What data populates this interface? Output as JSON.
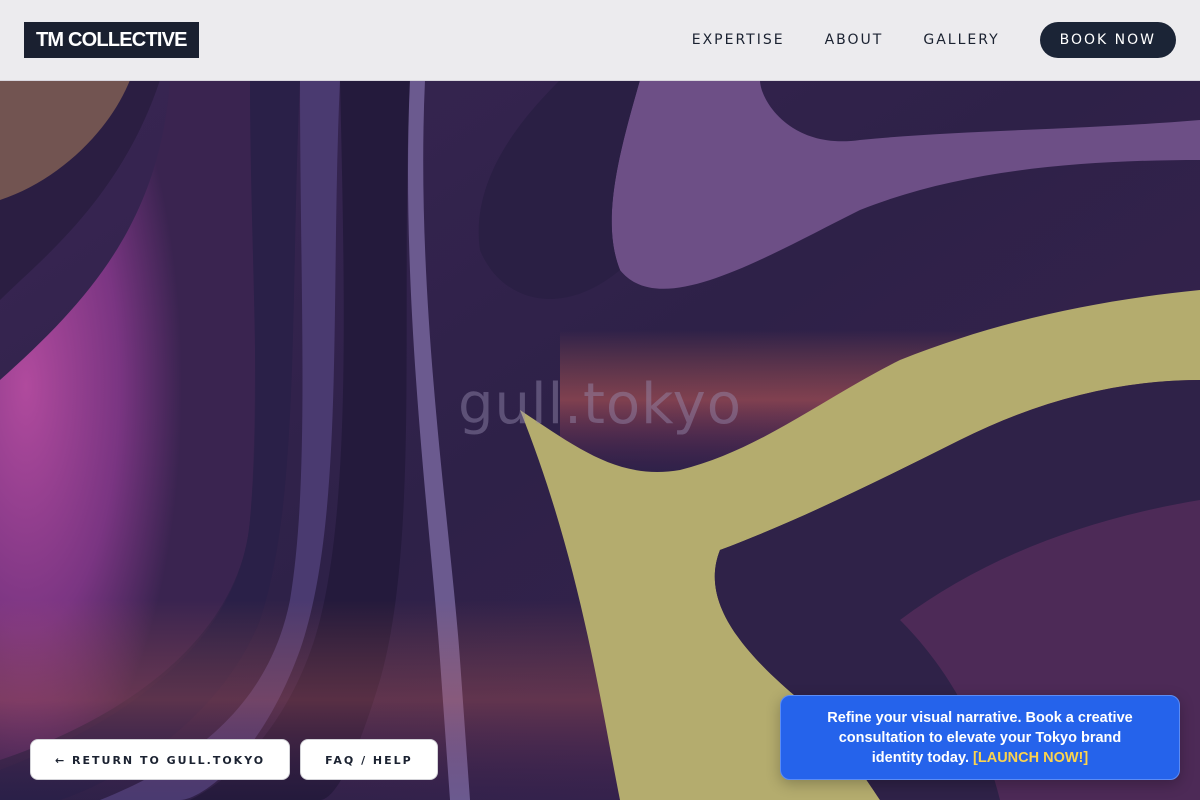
{
  "header": {
    "logo": "TM COLLECTIVE",
    "nav": [
      "EXPERTISE",
      "ABOUT",
      "GALLERY"
    ],
    "cta_label": "BOOK NOW"
  },
  "hero": {
    "watermark": "gull.tokyo"
  },
  "footer_buttons": {
    "return_label": "← RETURN TO GULL.TOKYO",
    "faq_label": "FAQ / HELP"
  },
  "promo": {
    "text": "Refine your visual narrative. Book a creative consultation to elevate your Tokyo brand identity today.",
    "cta": "[LAUNCH NOW!]"
  },
  "colors": {
    "header_bg": "#ecebee",
    "logo_bg": "#1a2030",
    "cta_bg": "#1b2436",
    "promo_bg": "#2563eb",
    "promo_cta": "#fcd34d",
    "art_purple": "#2e2148",
    "art_magenta": "#9a3d8d",
    "art_yellow": "#b4ac6e"
  }
}
